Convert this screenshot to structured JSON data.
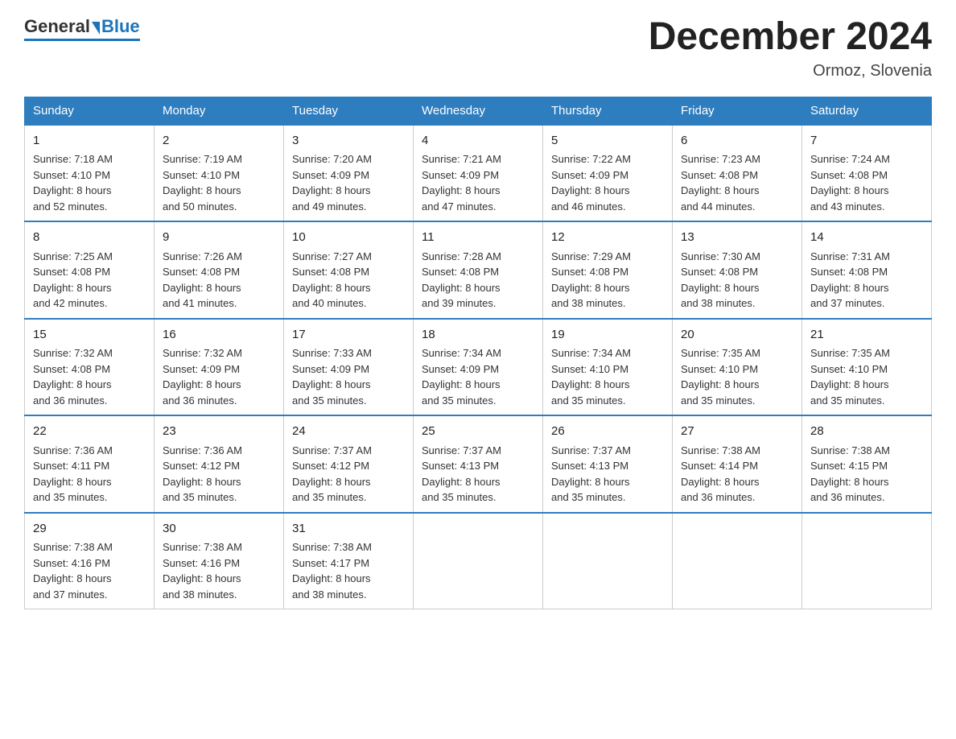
{
  "header": {
    "logo_general": "General",
    "logo_blue": "Blue",
    "month_title": "December 2024",
    "location": "Ormoz, Slovenia"
  },
  "days_of_week": [
    "Sunday",
    "Monday",
    "Tuesday",
    "Wednesday",
    "Thursday",
    "Friday",
    "Saturday"
  ],
  "weeks": [
    [
      {
        "day": "1",
        "sunrise": "7:18 AM",
        "sunset": "4:10 PM",
        "daylight": "8 hours and 52 minutes."
      },
      {
        "day": "2",
        "sunrise": "7:19 AM",
        "sunset": "4:10 PM",
        "daylight": "8 hours and 50 minutes."
      },
      {
        "day": "3",
        "sunrise": "7:20 AM",
        "sunset": "4:09 PM",
        "daylight": "8 hours and 49 minutes."
      },
      {
        "day": "4",
        "sunrise": "7:21 AM",
        "sunset": "4:09 PM",
        "daylight": "8 hours and 47 minutes."
      },
      {
        "day": "5",
        "sunrise": "7:22 AM",
        "sunset": "4:09 PM",
        "daylight": "8 hours and 46 minutes."
      },
      {
        "day": "6",
        "sunrise": "7:23 AM",
        "sunset": "4:08 PM",
        "daylight": "8 hours and 44 minutes."
      },
      {
        "day": "7",
        "sunrise": "7:24 AM",
        "sunset": "4:08 PM",
        "daylight": "8 hours and 43 minutes."
      }
    ],
    [
      {
        "day": "8",
        "sunrise": "7:25 AM",
        "sunset": "4:08 PM",
        "daylight": "8 hours and 42 minutes."
      },
      {
        "day": "9",
        "sunrise": "7:26 AM",
        "sunset": "4:08 PM",
        "daylight": "8 hours and 41 minutes."
      },
      {
        "day": "10",
        "sunrise": "7:27 AM",
        "sunset": "4:08 PM",
        "daylight": "8 hours and 40 minutes."
      },
      {
        "day": "11",
        "sunrise": "7:28 AM",
        "sunset": "4:08 PM",
        "daylight": "8 hours and 39 minutes."
      },
      {
        "day": "12",
        "sunrise": "7:29 AM",
        "sunset": "4:08 PM",
        "daylight": "8 hours and 38 minutes."
      },
      {
        "day": "13",
        "sunrise": "7:30 AM",
        "sunset": "4:08 PM",
        "daylight": "8 hours and 38 minutes."
      },
      {
        "day": "14",
        "sunrise": "7:31 AM",
        "sunset": "4:08 PM",
        "daylight": "8 hours and 37 minutes."
      }
    ],
    [
      {
        "day": "15",
        "sunrise": "7:32 AM",
        "sunset": "4:08 PM",
        "daylight": "8 hours and 36 minutes."
      },
      {
        "day": "16",
        "sunrise": "7:32 AM",
        "sunset": "4:09 PM",
        "daylight": "8 hours and 36 minutes."
      },
      {
        "day": "17",
        "sunrise": "7:33 AM",
        "sunset": "4:09 PM",
        "daylight": "8 hours and 35 minutes."
      },
      {
        "day": "18",
        "sunrise": "7:34 AM",
        "sunset": "4:09 PM",
        "daylight": "8 hours and 35 minutes."
      },
      {
        "day": "19",
        "sunrise": "7:34 AM",
        "sunset": "4:10 PM",
        "daylight": "8 hours and 35 minutes."
      },
      {
        "day": "20",
        "sunrise": "7:35 AM",
        "sunset": "4:10 PM",
        "daylight": "8 hours and 35 minutes."
      },
      {
        "day": "21",
        "sunrise": "7:35 AM",
        "sunset": "4:10 PM",
        "daylight": "8 hours and 35 minutes."
      }
    ],
    [
      {
        "day": "22",
        "sunrise": "7:36 AM",
        "sunset": "4:11 PM",
        "daylight": "8 hours and 35 minutes."
      },
      {
        "day": "23",
        "sunrise": "7:36 AM",
        "sunset": "4:12 PM",
        "daylight": "8 hours and 35 minutes."
      },
      {
        "day": "24",
        "sunrise": "7:37 AM",
        "sunset": "4:12 PM",
        "daylight": "8 hours and 35 minutes."
      },
      {
        "day": "25",
        "sunrise": "7:37 AM",
        "sunset": "4:13 PM",
        "daylight": "8 hours and 35 minutes."
      },
      {
        "day": "26",
        "sunrise": "7:37 AM",
        "sunset": "4:13 PM",
        "daylight": "8 hours and 35 minutes."
      },
      {
        "day": "27",
        "sunrise": "7:38 AM",
        "sunset": "4:14 PM",
        "daylight": "8 hours and 36 minutes."
      },
      {
        "day": "28",
        "sunrise": "7:38 AM",
        "sunset": "4:15 PM",
        "daylight": "8 hours and 36 minutes."
      }
    ],
    [
      {
        "day": "29",
        "sunrise": "7:38 AM",
        "sunset": "4:16 PM",
        "daylight": "8 hours and 37 minutes."
      },
      {
        "day": "30",
        "sunrise": "7:38 AM",
        "sunset": "4:16 PM",
        "daylight": "8 hours and 38 minutes."
      },
      {
        "day": "31",
        "sunrise": "7:38 AM",
        "sunset": "4:17 PM",
        "daylight": "8 hours and 38 minutes."
      },
      null,
      null,
      null,
      null
    ]
  ],
  "labels": {
    "sunrise": "Sunrise:",
    "sunset": "Sunset:",
    "daylight": "Daylight:"
  }
}
